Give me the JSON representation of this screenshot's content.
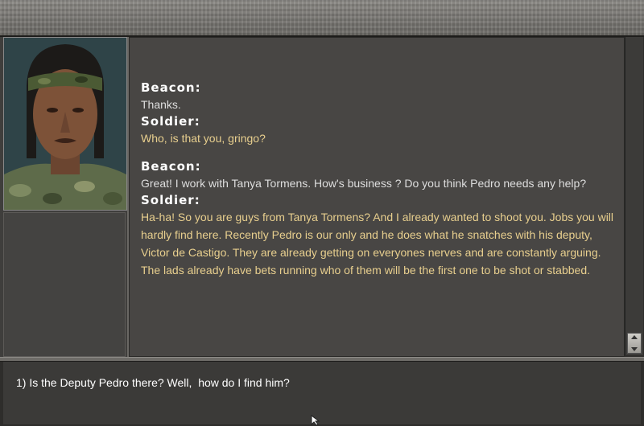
{
  "dialogue": {
    "entries": [
      {
        "speaker": "Beacon:",
        "text": "Thanks."
      },
      {
        "speaker": "Soldier:",
        "text": "Who, is that you, gringo?"
      },
      {
        "speaker": "Beacon:",
        "text": "Great! I work with Tanya Tormens. How's business ? Do you think Pedro needs any help?"
      },
      {
        "speaker": "Soldier:",
        "text": "Ha-ha! So you are guys from Tanya Tormens? And I already wanted to shoot you. Jobs you will hardly find here. Recently Pedro is our only and he does what he snatches with his deputy, Victor de Castigo. They are already getting on everyones nerves and are constantly arguing. The lads already have bets running who of them will be the first one to be shot or stabbed."
      }
    ]
  },
  "options": [
    {
      "label": "1) Is the Deputy Pedro there? Well,  how do I find him?"
    }
  ],
  "colors": {
    "speaker": "#ffffff",
    "beacon_text": "#dedede",
    "soldier_text": "#e8cf8e",
    "panel_bg": "#484644"
  }
}
